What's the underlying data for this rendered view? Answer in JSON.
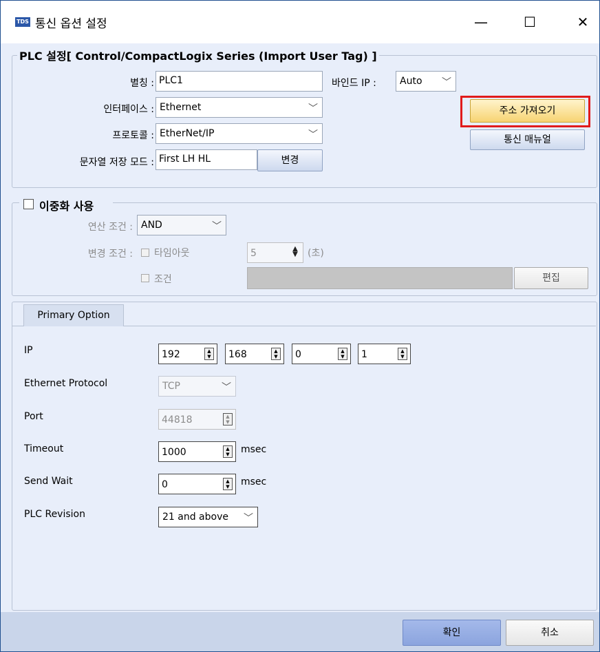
{
  "window": {
    "title": "통신 옵션 설정",
    "icon_text": "TDS",
    "minimize": "—",
    "maximize": "☐",
    "close": "✕"
  },
  "plc": {
    "legend": "PLC 설정[ Control/CompactLogix Series (Import User Tag) ]",
    "alias_label": "별칭 :",
    "alias_value": "PLC1",
    "bind_ip_label": "바인드 IP :",
    "bind_ip_value": "Auto",
    "interface_label": "인터페이스 :",
    "interface_value": "Ethernet",
    "protocol_label": "프로토콜 :",
    "protocol_value": "EtherNet/IP",
    "string_mode_label": "문자열 저장 모드 :",
    "string_mode_value": "First LH HL",
    "change_button": "변경",
    "get_address_button": "주소 가져오기",
    "manual_button": "통신 매뉴얼"
  },
  "redundancy": {
    "legend": "이중화 사용",
    "checked": false,
    "op_label": "연산 조건 :",
    "op_value": "AND",
    "change_cond_label": "변경 조건 :",
    "timeout_check_label": "타임아웃",
    "timeout_value": "5",
    "timeout_unit": "(초)",
    "condition_check_label": "조건",
    "condition_value": "",
    "edit_button": "편집"
  },
  "primary": {
    "tab_label": "Primary Option",
    "ip_label": "IP",
    "ip": [
      "192",
      "168",
      "0",
      "1"
    ],
    "protocol_label": "Ethernet Protocol",
    "protocol_value": "TCP",
    "port_label": "Port",
    "port_value": "44818",
    "timeout_label": "Timeout",
    "timeout_value": "1000",
    "timeout_unit": "msec",
    "send_wait_label": "Send Wait",
    "send_wait_value": "0",
    "send_wait_unit": "msec",
    "revision_label": "PLC Revision",
    "revision_value": "21 and above"
  },
  "footer": {
    "ok_button": "확인",
    "cancel_button": "취소"
  },
  "colors": {
    "highlight_border": "#e11b1b",
    "window_border": "#1f4f8f",
    "panel_bg": "#e8eefa"
  }
}
